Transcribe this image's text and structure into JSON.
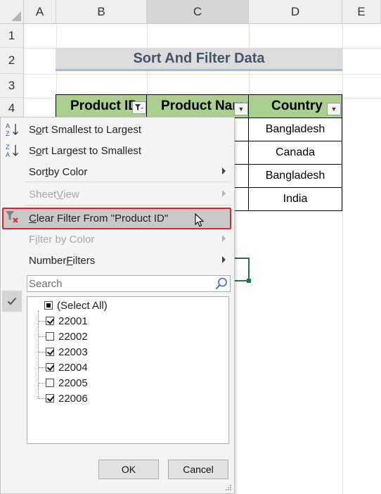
{
  "columns": [
    "A",
    "B",
    "C",
    "D",
    "E"
  ],
  "rows": [
    "1",
    "2",
    "3",
    "4"
  ],
  "title": "Sort And Filter Data",
  "table": {
    "headers": [
      "Product ID",
      "Product Name",
      "Country"
    ],
    "rows": [
      {
        "country": "Bangladesh"
      },
      {
        "country": "Canada"
      },
      {
        "country": "Bangladesh"
      },
      {
        "country": "India"
      }
    ]
  },
  "menu": {
    "sort_asc": {
      "pre": "S",
      "key": "o",
      "post": "rt Smallest to Largest"
    },
    "sort_desc": {
      "pre": "S",
      "key": "o",
      "post": "rt Largest to Smallest"
    },
    "sort_color": {
      "pre": "Sor",
      "key": "t",
      "post": " by Color"
    },
    "sheet_view": {
      "pre": "Sheet ",
      "key": "V",
      "post": "iew"
    },
    "clear_filter": {
      "pre": "",
      "key": "C",
      "post": "lear Filter From \"Product ID\""
    },
    "filter_color": {
      "pre": "F",
      "key": "i",
      "post": "lter by Color"
    },
    "number_filters": {
      "pre": "Number ",
      "key": "F",
      "post": "ilters"
    },
    "search_placeholder": "Search",
    "items": [
      {
        "label": "(Select All)",
        "state": "partial"
      },
      {
        "label": "22001",
        "state": "checked"
      },
      {
        "label": "22002",
        "state": "unchecked"
      },
      {
        "label": "22003",
        "state": "checked"
      },
      {
        "label": "22004",
        "state": "checked"
      },
      {
        "label": "22005",
        "state": "unchecked"
      },
      {
        "label": "22006",
        "state": "checked"
      }
    ],
    "ok_label": "OK",
    "cancel_label": "Cancel"
  },
  "colors": {
    "header_fill": "#a9d08e",
    "title_fill": "#dcdcdc",
    "title_text": "#44546a",
    "highlight_border": "#d9262b",
    "selection_green": "#217346"
  }
}
